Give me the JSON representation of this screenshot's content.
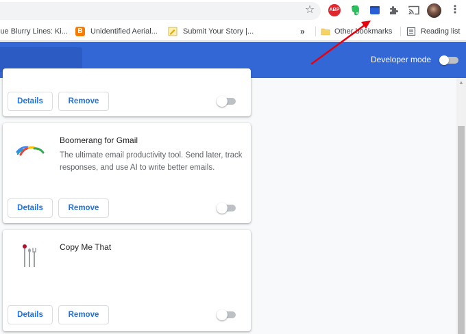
{
  "toolbar": {
    "icons": [
      "star-icon",
      "adblock-plus-icon",
      "evernote-icon",
      "boomerang-icon",
      "extensions-puzzle-icon",
      "cast-icon",
      "profile-avatar",
      "more-menu-icon"
    ],
    "abp_label": "ABP",
    "star_glyph": "☆",
    "menu_glyph": "⋮"
  },
  "bookmarks": {
    "items": [
      {
        "label": "lue Blurry Lines: Ki..."
      },
      {
        "label": "Unidentified Aerial..."
      },
      {
        "label": "Submit Your Story |..."
      }
    ],
    "overflow_glyph": "»",
    "other_bookmarks": "Other bookmarks",
    "reading_list": "Reading list",
    "blogger_glyph": "B"
  },
  "header": {
    "developer_mode_label": "Developer mode",
    "developer_mode_on": false
  },
  "extensions": [
    {
      "name": "",
      "description": "",
      "details_label": "Details",
      "remove_label": "Remove",
      "enabled": false
    },
    {
      "name": "Boomerang for Gmail",
      "description": "The ultimate email productivity tool. Send later, track responses, and use AI to write better emails.",
      "details_label": "Details",
      "remove_label": "Remove",
      "enabled": false
    },
    {
      "name": "Copy Me That",
      "description": "",
      "details_label": "Details",
      "remove_label": "Remove",
      "enabled": false
    }
  ],
  "colors": {
    "header_blue": "#3367d6",
    "link_blue": "#1a73e8",
    "arrow_red": "#e8000d"
  }
}
